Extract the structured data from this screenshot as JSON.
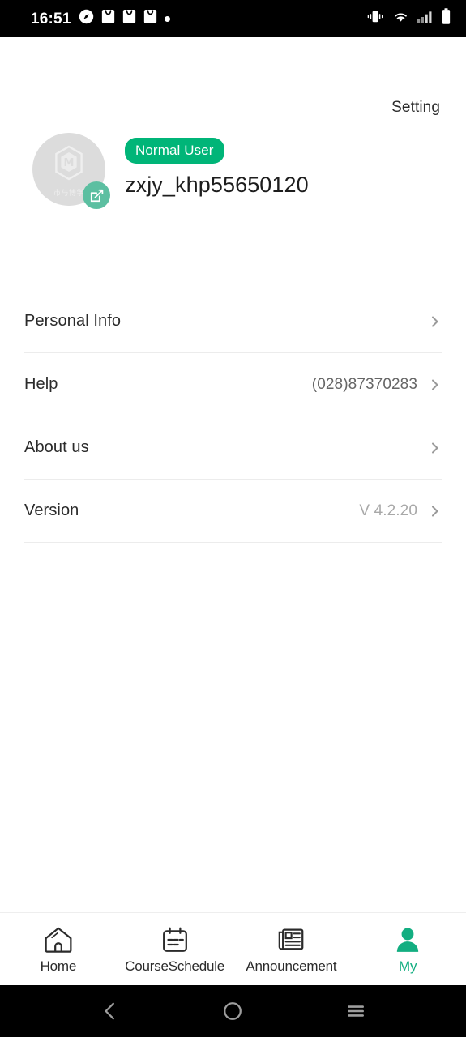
{
  "statusbar": {
    "time": "16:51",
    "left_icons": [
      "compass-icon",
      "shopping-bag-icon",
      "shopping-bag-icon",
      "shopping-bag-icon",
      "dot-icon"
    ],
    "right_icons": [
      "vibrate-icon",
      "wifi-icon",
      "signal-icon",
      "battery-icon"
    ]
  },
  "header": {
    "setting_label": "Setting"
  },
  "profile": {
    "avatar_logo_text": "市与博学",
    "avatar_bg": "#dcdcdc",
    "edit_badge_bg": "#5cbfa1",
    "badge_label": "Normal User",
    "badge_bg": "#00b578",
    "username": "zxjy_khp55650120"
  },
  "menu": {
    "items": [
      {
        "label": "Personal Info",
        "value": "",
        "name": "personal-info"
      },
      {
        "label": "Help",
        "value": "(028)87370283",
        "name": "help"
      },
      {
        "label": "About us",
        "value": "",
        "name": "about-us"
      },
      {
        "label": "Version",
        "value": "V 4.2.20",
        "name": "version",
        "muted": true
      }
    ]
  },
  "tabbar": {
    "active_color": "#13ae81",
    "items": [
      {
        "label": "Home",
        "icon": "home-icon",
        "active": false
      },
      {
        "label": "CourseSchedule",
        "icon": "calendar-icon",
        "active": false
      },
      {
        "label": "Announcement",
        "icon": "newspaper-icon",
        "active": false
      },
      {
        "label": "My",
        "icon": "person-icon",
        "active": true
      }
    ]
  },
  "navbar": {
    "back_label": "back-button",
    "home_label": "home-button",
    "recents_label": "recents-button"
  }
}
